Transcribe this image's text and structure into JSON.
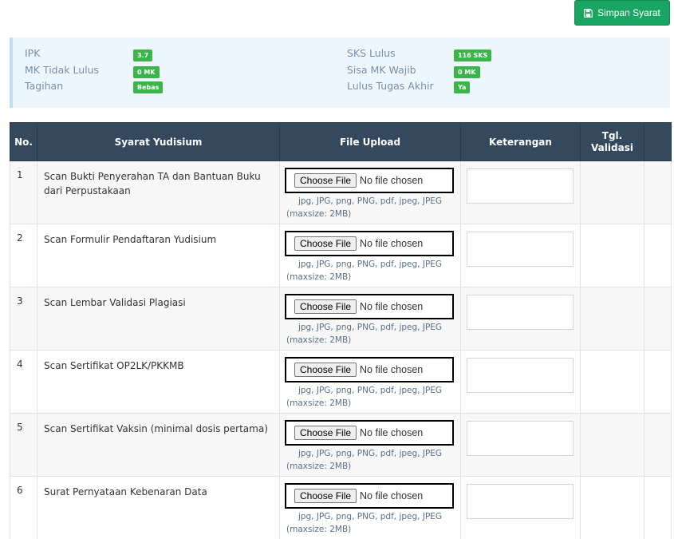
{
  "toolbar": {
    "save_label": "Simpan Syarat"
  },
  "info": {
    "ipk_label": "IPK",
    "ipk_value": "3.7",
    "mk_tidak_lulus_label": "MK Tidak Lulus",
    "mk_tidak_lulus_value": "0 MK",
    "tagihan_label": "Tagihan",
    "tagihan_value": "Bebas",
    "sks_lulus_label": "SKS Lulus",
    "sks_lulus_value": "116 SKS",
    "sisa_mk_wajib_label": "Sisa MK Wajib",
    "sisa_mk_wajib_value": "0 MK",
    "lulus_ta_label": "Lulus Tugas Akhir",
    "lulus_ta_value": "Ya"
  },
  "table": {
    "headers": [
      "No.",
      "Syarat Yudisium",
      "File Upload",
      "Keterangan",
      "Tgl. Validasi",
      ""
    ],
    "file_button": "Choose File",
    "file_status": "No file chosen",
    "file_types": "jpg, JPG, png, PNG, pdf, jpeg, JPEG",
    "file_size": "(maxsize: 2MB)",
    "rows": [
      {
        "no": "1",
        "syarat": "Scan Bukti Penyerahan TA dan Bantuan Buku dari Perpustakaan"
      },
      {
        "no": "2",
        "syarat": "Scan Formulir Pendaftaran Yudisium"
      },
      {
        "no": "3",
        "syarat": "Scan Lembar Validasi Plagiasi"
      },
      {
        "no": "4",
        "syarat": "Scan Sertifikat OP2LK/PKKMB"
      },
      {
        "no": "5",
        "syarat": "Scan Sertifikat Vaksin (minimal dosis pertama)"
      },
      {
        "no": "6",
        "syarat": "Surat Pernyataan Kebenaran Data"
      }
    ]
  },
  "colors": {
    "save_button": "#1aa563",
    "header_bg": "#34495e",
    "badge": "#3bb44a",
    "info_bg": "#eef6fd"
  }
}
